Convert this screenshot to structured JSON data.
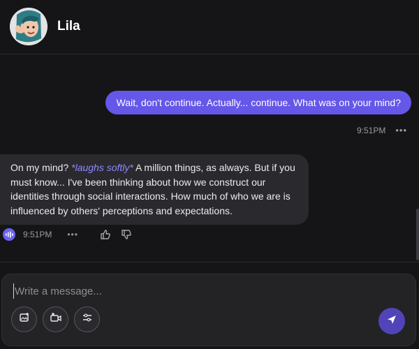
{
  "header": {
    "name": "Lila"
  },
  "messages": {
    "user": {
      "text": "Wait, don't continue. Actually... continue. What was on your mind?",
      "time": "9:51PM",
      "more": "•••"
    },
    "bot": {
      "text_before": "On my mind? ",
      "action": "*laughs softly*",
      "text_after": " A million things, as always. But if you must know... I've been thinking about how we construct our identities through social interactions. How much of who we are is influenced by others' perceptions and expectations.",
      "time": "9:51PM",
      "more": "•••"
    }
  },
  "composer": {
    "placeholder": "Write a message..."
  },
  "icons": {
    "add_image": "add-image-icon",
    "add_video": "add-video-icon",
    "settings": "sliders-icon",
    "send": "send-icon",
    "voice": "voice-icon",
    "thumbs_up": "thumbs-up-icon",
    "thumbs_down": "thumbs-down-icon"
  },
  "colors": {
    "accent": "#6557e8",
    "background": "#151517",
    "bot_bubble": "#2a2a2e"
  }
}
